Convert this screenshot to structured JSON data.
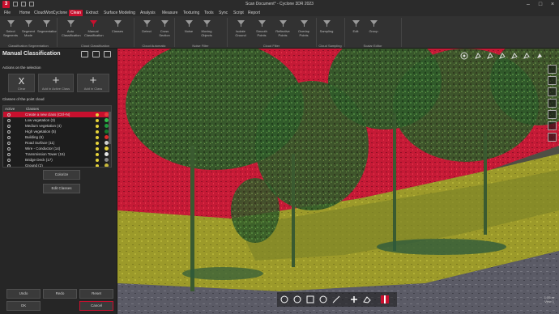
{
  "window": {
    "title": "Scan Document* - Cyclone 3DR 2023",
    "logo": "3"
  },
  "menu": {
    "items": [
      "File",
      "Home",
      "CloudWorx",
      "Cyclone",
      "Clean",
      "Extract",
      "Surface Modeling",
      "Analysis",
      "Measure",
      "Texturing",
      "Tools",
      "Sync",
      "Script",
      "Report"
    ],
    "active_index": 4
  },
  "ribbon": {
    "buttons": [
      {
        "label": "Select Segments",
        "icon": "select-icon"
      },
      {
        "label": "Segment Mode",
        "icon": "segment-icon"
      },
      {
        "label": "Segmentation",
        "icon": "segmentation-icon"
      },
      {
        "label": "Auto Classification",
        "icon": "auto-class-icon"
      },
      {
        "label": "Manual Classification",
        "icon": "manual-class-icon"
      },
      {
        "label": "Classes",
        "icon": "classes-icon"
      },
      {
        "label": "Detect",
        "icon": "detect-icon"
      },
      {
        "label": "Cross Section",
        "icon": "cross-section-icon"
      },
      {
        "label": "Noise",
        "icon": "noise-icon"
      },
      {
        "label": "Moving Objects",
        "icon": "moving-objects-icon"
      },
      {
        "label": "Isolate Ground",
        "icon": "ground-icon"
      },
      {
        "label": "Smooth Points",
        "icon": "smooth-icon"
      },
      {
        "label": "Reflective Points",
        "icon": "reflective-icon"
      },
      {
        "label": "Overlap Points",
        "icon": "overlap-icon"
      },
      {
        "label": "Sampling",
        "icon": "sampling-icon"
      },
      {
        "label": "Edit",
        "icon": "edit-icon"
      },
      {
        "label": "Group",
        "icon": "group-icon"
      }
    ],
    "groups": [
      "Classification Segmentation",
      "Cloud Classification",
      "Cloud Automatic Segmentation",
      "Noise Filter",
      "Cloud Filter",
      "Cloud Sampling",
      "Scalar Editor"
    ]
  },
  "panel": {
    "title": "Manual Classification",
    "actions_header": "Actions on the selection",
    "actions": [
      {
        "label": "Clear",
        "icon": "x"
      },
      {
        "label": "Add in Active Class",
        "icon": "+"
      },
      {
        "label": "Add in Class",
        "icon": "+"
      }
    ],
    "classes_header": "Classes of the point cloud",
    "table_headers": {
      "active": "Active",
      "classes": "Classes"
    },
    "classes": [
      {
        "name": "Create a new class (Ctrl+N)",
        "color": "#e63b3b"
      },
      {
        "name": "Low vegetation (3)",
        "color": "#2fbf4a"
      },
      {
        "name": "Medium vegetation (4)",
        "color": "#1e9b3c"
      },
      {
        "name": "High vegetation (5)",
        "color": "#16782c"
      },
      {
        "name": "Building (6)",
        "color": "#e02a2a"
      },
      {
        "name": "Road Surface (11)",
        "color": "#d0d0d0"
      },
      {
        "name": "Wire - Conductor (14)",
        "color": "#e6d33a"
      },
      {
        "name": "Transmission Tower (15)",
        "color": "#e6e6e6"
      },
      {
        "name": "Bridge Deck (17)",
        "color": "#8a8a8a"
      },
      {
        "name": "Ground (2)",
        "color": "#c8b83a"
      }
    ],
    "selected_class": 0,
    "colorize_label": "Colorize",
    "edit_classes_label": "Edit Classes",
    "undo_label": "Undo",
    "redo_label": "Redo",
    "reset_label": "Reset",
    "ok_label": "OK",
    "cancel_label": "Cancel"
  },
  "viewport": {
    "scale_info": "1.25 m",
    "view_info": "View 1"
  }
}
